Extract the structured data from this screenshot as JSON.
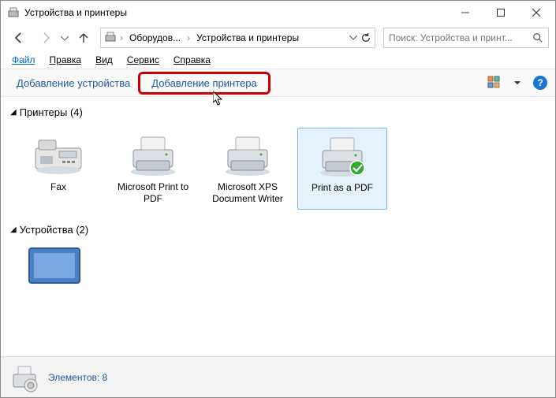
{
  "window": {
    "title": "Устройства и принтеры"
  },
  "nav": {
    "crumb1": "Оборудов...",
    "crumb2": "Устройства и принтеры"
  },
  "search": {
    "placeholder": "Поиск: Устройства и принт..."
  },
  "menu": {
    "file": "Файл",
    "edit": "Правка",
    "view": "Вид",
    "service": "Сервис",
    "help": "Справка"
  },
  "toolbar": {
    "add_device": "Добавление устройства",
    "add_printer": "Добавление принтера"
  },
  "groups": {
    "printers_header": "Принтеры (4)",
    "devices_header": "Устройства (2)"
  },
  "printers": [
    {
      "label": "Fax",
      "type": "fax"
    },
    {
      "label": "Microsoft Print to PDF",
      "type": "printer"
    },
    {
      "label": "Microsoft XPS Document Writer",
      "type": "printer"
    },
    {
      "label": "Print as a PDF",
      "type": "printer",
      "default": true,
      "selected": true
    }
  ],
  "status": {
    "label": "Элементов:",
    "count": "8"
  },
  "help_glyph": "?"
}
